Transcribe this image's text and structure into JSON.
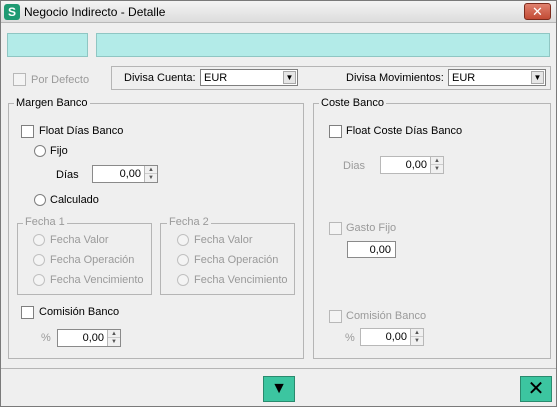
{
  "window": {
    "title": "Negocio Indirecto - Detalle",
    "close_glyph": "✕",
    "app_icon_glyph": "S"
  },
  "top": {
    "por_defecto_label": "Por Defecto",
    "divisa_cuenta_label": "Divisa Cuenta:",
    "divisa_cuenta_value": "EUR",
    "divisa_movimientos_label": "Divisa Movimientos:",
    "divisa_movimientos_value": "EUR"
  },
  "margen": {
    "title": "Margen Banco",
    "float_label": "Float Días Banco",
    "fijo_label": "Fijo",
    "dias_label": "Días",
    "dias_value": "0,00",
    "calculado_label": "Calculado",
    "fecha1": {
      "title": "Fecha 1",
      "options": [
        "Fecha Valor",
        "Fecha Operación",
        "Fecha Vencimiento"
      ]
    },
    "fecha2": {
      "title": "Fecha 2",
      "options": [
        "Fecha Valor",
        "Fecha Operación",
        "Fecha Vencimiento"
      ]
    },
    "comision_label": "Comisión Banco",
    "pct_label": "%",
    "pct_value": "0,00"
  },
  "coste": {
    "title": "Coste Banco",
    "float_label": "Float Coste Días Banco",
    "dias_label": "Dias",
    "dias_value": "0,00",
    "gasto_label": "Gasto Fijo",
    "gasto_value": "0,00",
    "comision_label": "Comisión Banco",
    "pct_label": "%",
    "pct_value": "0,00"
  },
  "footer": {
    "down_glyph": "▼",
    "close_glyph": "✕"
  },
  "colors": {
    "cyan_field": "#b3ebe8",
    "green_button": "#3cc5a0"
  }
}
